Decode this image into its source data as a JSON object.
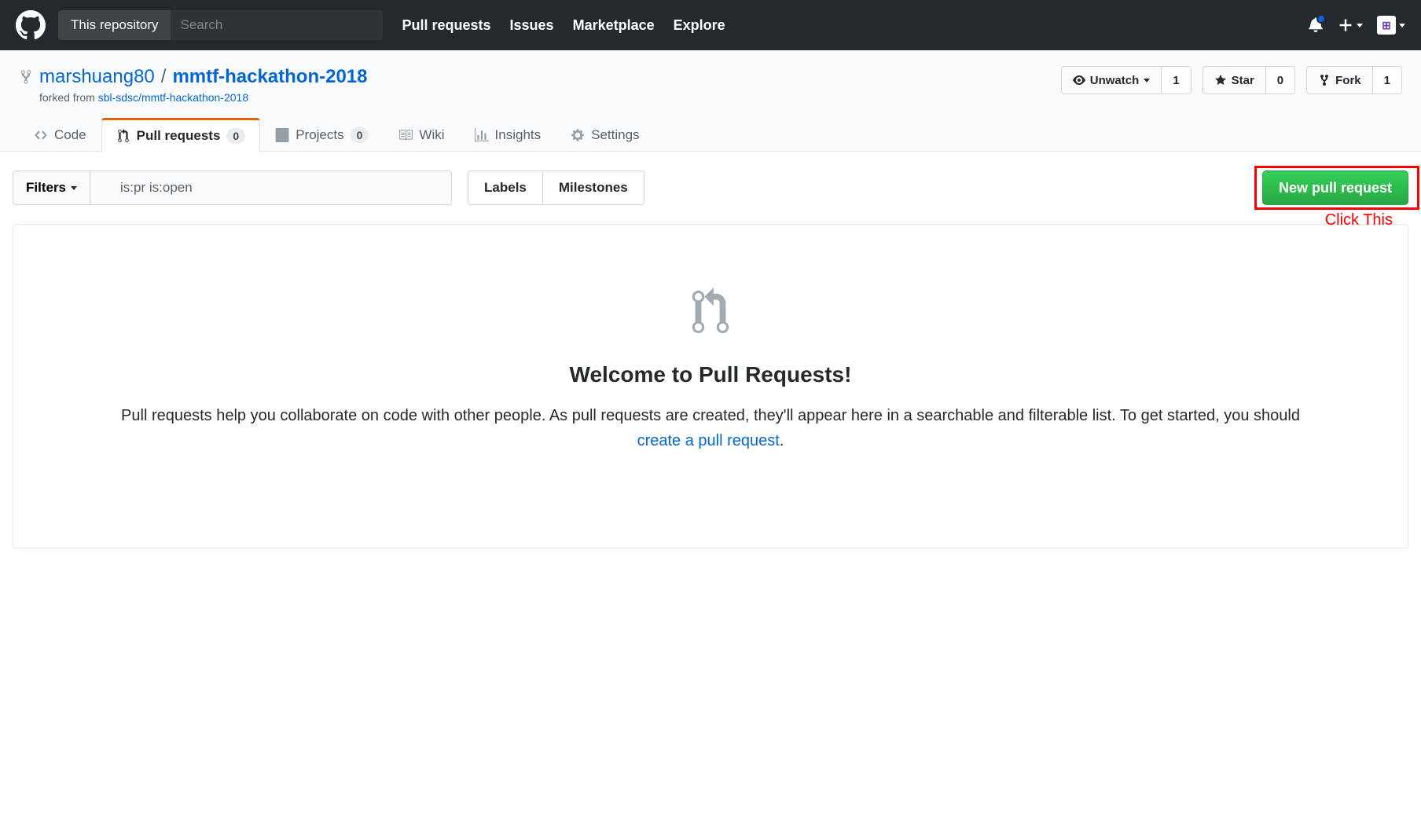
{
  "header": {
    "search_scope": "This repository",
    "search_placeholder": "Search",
    "nav": {
      "pulls": "Pull requests",
      "issues": "Issues",
      "marketplace": "Marketplace",
      "explore": "Explore"
    }
  },
  "repo": {
    "owner": "marshuang80",
    "name": "mmtf-hackathon-2018",
    "separator": "/",
    "forked_prefix": "forked from ",
    "forked_from": "sbl-sdsc/mmtf-hackathon-2018",
    "actions": {
      "unwatch_label": "Unwatch",
      "unwatch_count": "1",
      "star_label": "Star",
      "star_count": "0",
      "fork_label": "Fork",
      "fork_count": "1"
    }
  },
  "tabs": {
    "code": "Code",
    "pulls": "Pull requests",
    "pulls_count": "0",
    "projects": "Projects",
    "projects_count": "0",
    "wiki": "Wiki",
    "insights": "Insights",
    "settings": "Settings"
  },
  "toolbar": {
    "filters": "Filters",
    "search_value": "is:pr is:open",
    "labels": "Labels",
    "milestones": "Milestones",
    "new_pr": "New pull request"
  },
  "annotation": {
    "click_this": "Click This"
  },
  "blankslate": {
    "title": "Welcome to Pull Requests!",
    "text1": "Pull requests help you collaborate on code with other people. As pull requests are created, they'll appear here in a searchable and filterable list. To get started, you should ",
    "link": "create a pull request",
    "text2": "."
  }
}
